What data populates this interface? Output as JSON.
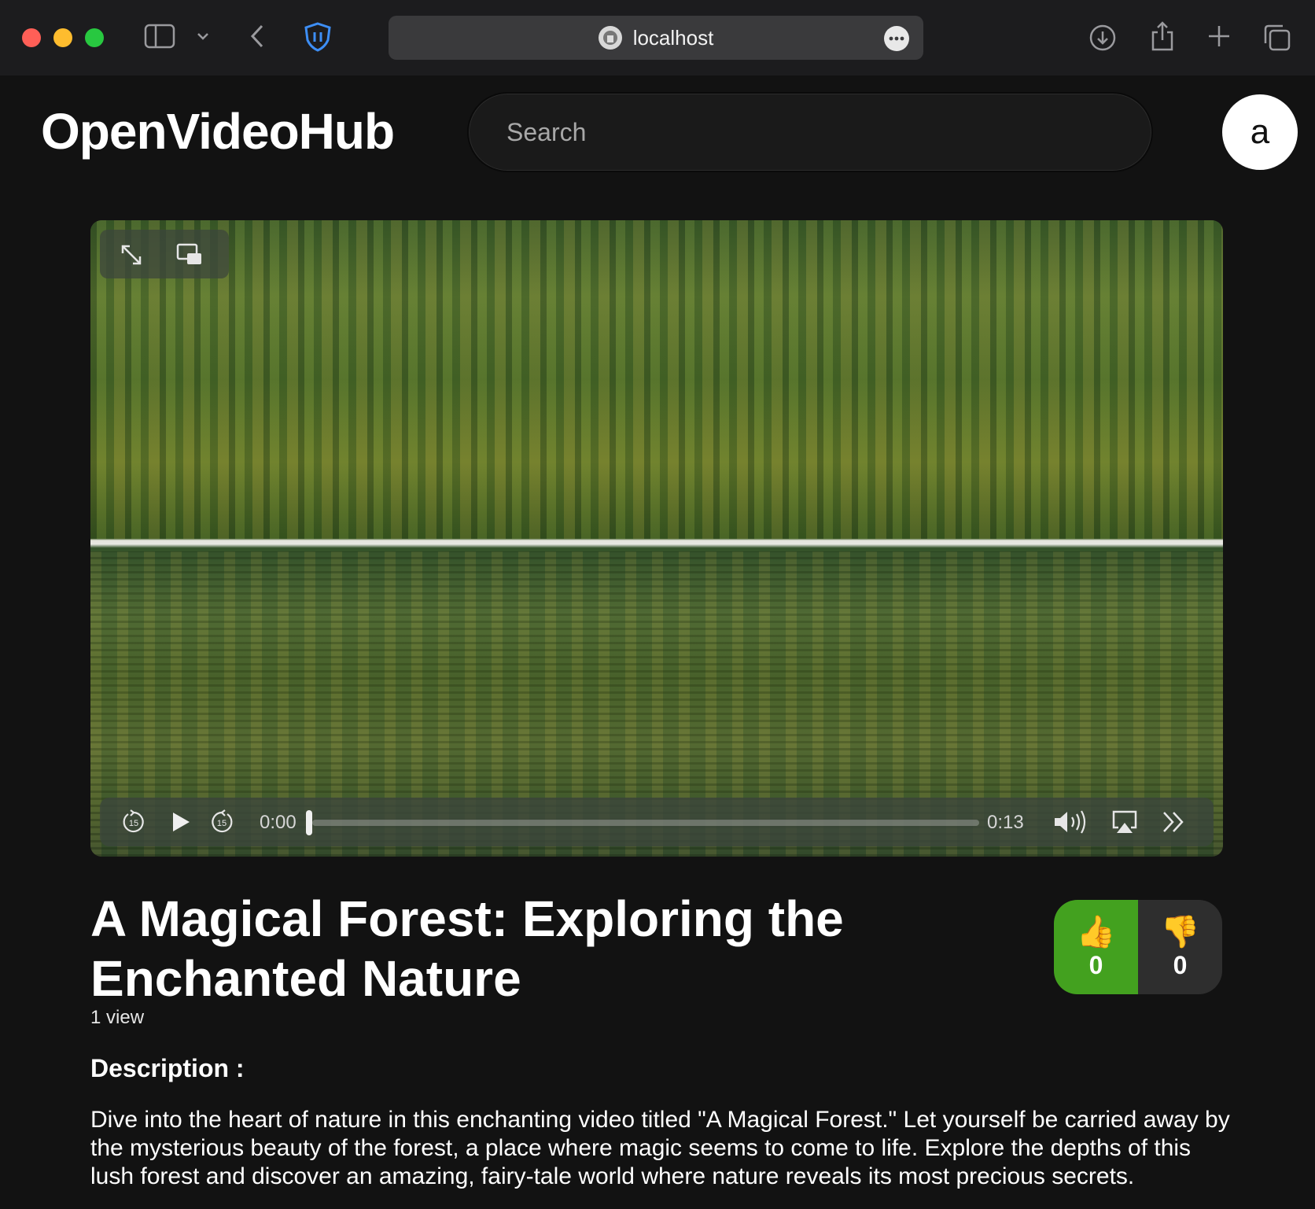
{
  "browser": {
    "url": "localhost",
    "colors": {
      "close": "#ff5f57",
      "minimize": "#febc2e",
      "maximize": "#28c840"
    }
  },
  "header": {
    "logo": "OpenVideoHub",
    "search_placeholder": "Search",
    "avatar_letter": "a"
  },
  "video": {
    "current_time": "0:00",
    "duration": "0:13",
    "progress_fraction": 0
  },
  "details": {
    "title": "A Magical Forest: Exploring the Enchanted Nature",
    "views": "1 view",
    "likes": "0",
    "dislikes": "0",
    "like_color": "#43a11f",
    "description_label": "Description :",
    "description": "Dive into the heart of nature in this enchanting video titled \"A Magical Forest.\" Let yourself be carried away by the mysterious beauty of the forest, a place where magic seems to come to life. Explore the depths of this lush forest and discover an amazing, fairy-tale world where nature reveals its most precious secrets."
  }
}
